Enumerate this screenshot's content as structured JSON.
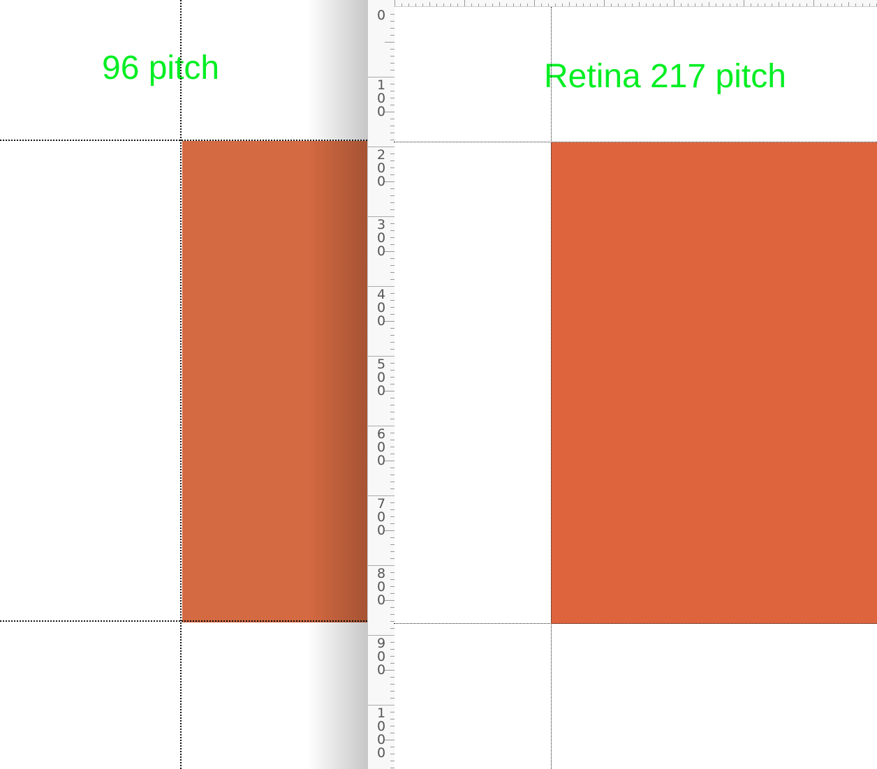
{
  "left_panel": {
    "label": "96 pitch",
    "rect_color": "#d46a42"
  },
  "right_panel": {
    "label": "Retina 217 pitch",
    "rect_color": "#de643e"
  },
  "label_color": "#00ee22",
  "vertical_ruler": {
    "labels": [
      "0",
      "100",
      "200",
      "300",
      "400",
      "500",
      "600",
      "700",
      "800",
      "900",
      "1000"
    ]
  }
}
